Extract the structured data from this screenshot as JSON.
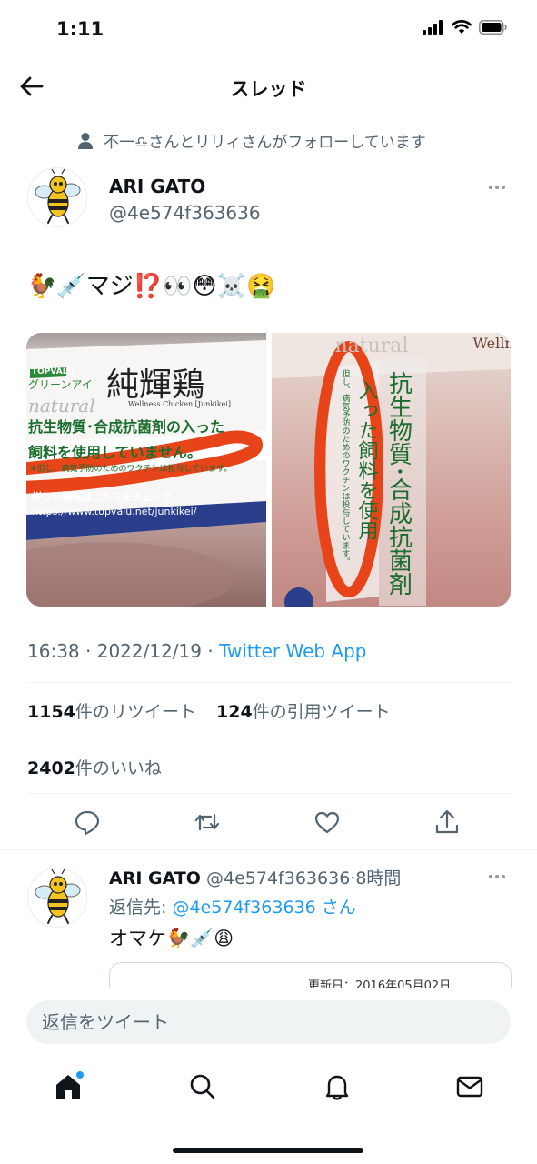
{
  "status_bar": {
    "time": "1:11"
  },
  "header": {
    "title": "スレッド"
  },
  "social_context": "不一♎さんとリリィさんがフォローしています",
  "tweet": {
    "author_name": "ARI GATO",
    "author_handle": "@4e574f363636",
    "text": "🐓💉マジ⁉️👀😳☠️🤮",
    "media": [
      {
        "title": "純輝鶏",
        "subtitle": "Wellness Chicken [Junkikei]",
        "brand": "TOPVALU",
        "brand_sub": "グリーンアイ",
        "natural": "natural",
        "line1": "抗生物質･合成抗菌剤の入った",
        "line2": "飼料を使用していません。",
        "note": "※但し、病気予防のためのワクチンは投与しています。",
        "detail": "詳しい情報はこちらをチェック",
        "url": "https://www.topvalu.net/junkikei/"
      },
      {
        "natural": "natural",
        "brand_cut": "Welln",
        "vertical_main": "抗生物質･合成抗菌剤",
        "vertical_red": "入った飼料を使用",
        "vertical_note": "但し、病気予防のためのワクチンは投与しています。"
      }
    ],
    "time": "16:38",
    "date": "2022/12/19",
    "source": "Twitter Web App",
    "retweets_count": "1154",
    "retweets_label": "件のリツイート",
    "quotes_count": "124",
    "quotes_label": "件の引用ツイート",
    "likes_count": "2402",
    "likes_label": "件のいいね"
  },
  "reply": {
    "author_name": "ARI GATO",
    "author_handle": "@4e574f363636",
    "time_ago": "8時間",
    "reply_to_prefix": "返信先: ",
    "reply_to_handle": "@4e574f363636",
    "reply_to_suffix": " さん",
    "text": "オマケ🐓💉😩",
    "quote_date": "更新日：2016年05月02日"
  },
  "composer": {
    "placeholder": "返信をツイート"
  },
  "icons": {
    "back": "arrow-left-icon",
    "reply": "reply-icon",
    "retweet": "retweet-icon",
    "like": "heart-icon",
    "share": "share-icon",
    "home": "home-icon",
    "search": "search-icon",
    "notifications": "bell-icon",
    "messages": "mail-icon"
  },
  "colors": {
    "accent": "#1d9bf0",
    "text": "#0f1419",
    "secondary": "#536471",
    "highlight_marker": "#e8441a"
  }
}
